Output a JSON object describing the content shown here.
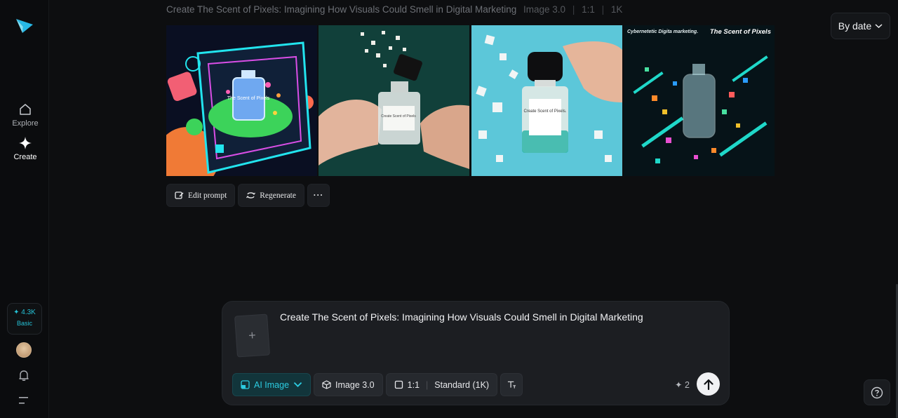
{
  "sidebar": {
    "logo": "paper-plane-logo",
    "nav": [
      {
        "label": "Explore",
        "icon": "home-icon"
      },
      {
        "label": "Create",
        "icon": "sparkle-icon"
      }
    ],
    "credits": {
      "amount": "✦ 4.3K",
      "plan": "Basic"
    },
    "icons": [
      "avatar",
      "bell-icon",
      "menu-icon"
    ]
  },
  "header": {
    "prompt": "Create The Scent of Pixels: Imagining How Visuals Could Smell in Digital Marketing",
    "model": "Image 3.0",
    "ratio": "1:1",
    "resolution": "1K",
    "sort_label": "By date"
  },
  "images": [
    {
      "label_text": "The Scent of Pixels"
    },
    {
      "label_text": "Create Scent of Pixels"
    },
    {
      "label_text": "Create Scent of Pixels."
    },
    {
      "label_text": "The Scent of Pixels",
      "headline": "Cybernetetic Digita marketing."
    }
  ],
  "actions": {
    "edit_prompt": "Edit prompt",
    "regenerate": "Regenerate",
    "more": "···"
  },
  "composer": {
    "text": "Create The Scent of Pixels: Imagining How Visuals Could Smell in Digital Marketing",
    "add_ref": "+",
    "mode": "AI Image",
    "model": "Image 3.0",
    "ratio": "1:1",
    "quality": "Standard (1K)",
    "cost": "✦ 2"
  },
  "colors": {
    "accent": "#2ccbe0",
    "background": "#0d0e10",
    "panel": "#1c1e22"
  }
}
